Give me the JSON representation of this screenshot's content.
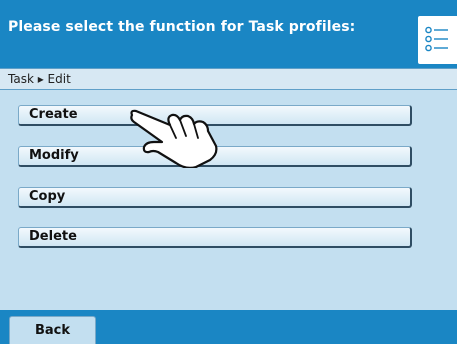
{
  "header": {
    "title": "Please select the function for Task profiles:",
    "menu_icon": "list-icon"
  },
  "breadcrumb": {
    "path": "Task ▸ Edit"
  },
  "functions": [
    {
      "label": "Create"
    },
    {
      "label": "Modify"
    },
    {
      "label": "Copy"
    },
    {
      "label": "Delete"
    }
  ],
  "footer": {
    "back_label": "Back"
  },
  "pointer": {
    "icon": "pointing-hand-icon"
  },
  "colors": {
    "header_bg": "#1a86c4",
    "content_bg": "#c3dff0",
    "breadcrumb_bg": "#d7e8f3"
  }
}
